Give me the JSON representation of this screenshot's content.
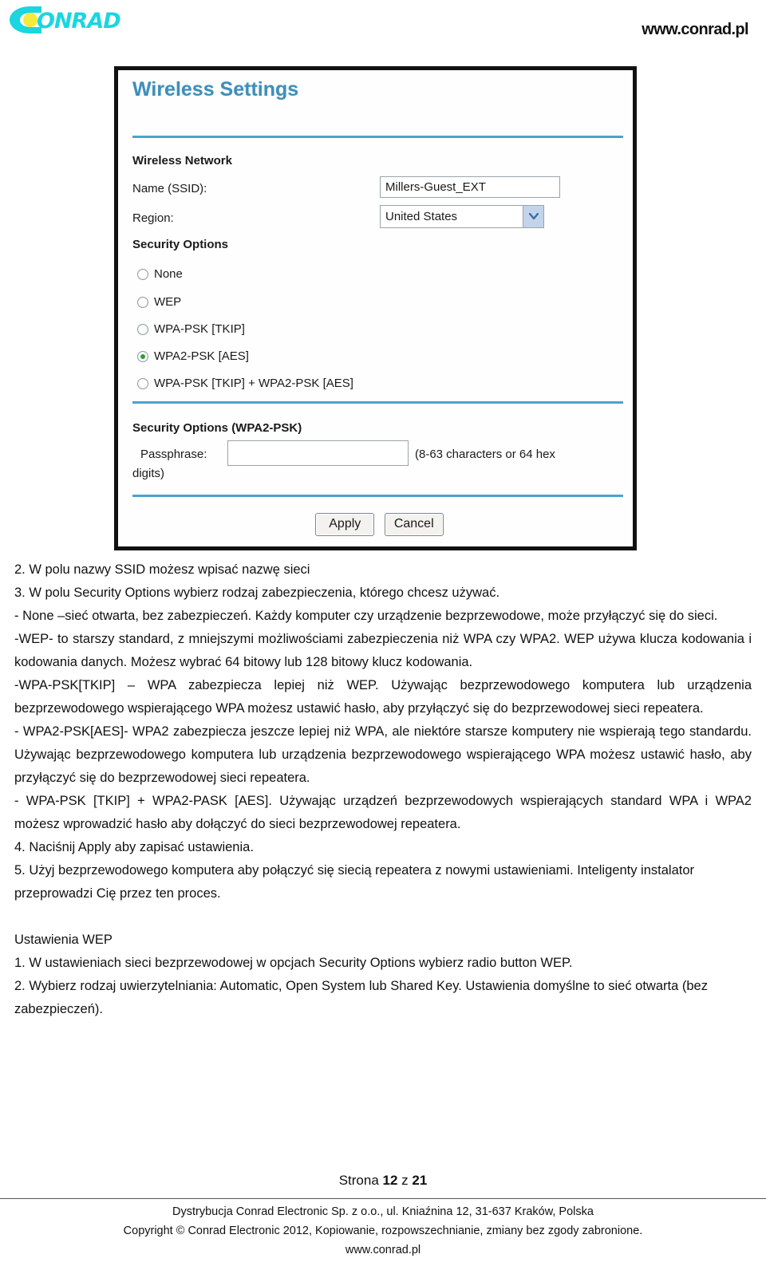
{
  "header": {
    "logo_text": "CONRAD",
    "site_url": "www.conrad.pl"
  },
  "screenshot": {
    "title": "Wireless Settings",
    "section_wireless_network": "Wireless Network",
    "label_name_ssid": "Name (SSID):",
    "ssid_value": "Millers-Guest_EXT",
    "label_region": "Region:",
    "region_value": "United States",
    "section_security_options": "Security Options",
    "security_options": [
      {
        "label": "None",
        "selected": false
      },
      {
        "label": "WEP",
        "selected": false
      },
      {
        "label": "WPA-PSK [TKIP]",
        "selected": false
      },
      {
        "label": "WPA2-PSK [AES]",
        "selected": true
      },
      {
        "label": "WPA-PSK [TKIP] + WPA2-PSK [AES]",
        "selected": false
      }
    ],
    "section_security_options_wpa2": "Security Options (WPA2-PSK)",
    "label_passphrase": "Passphrase:",
    "passphrase_value": "",
    "passphrase_hint": "(8-63 characters or 64 hex",
    "passphrase_hint2": "digits)",
    "apply_label": "Apply",
    "cancel_label": "Cancel"
  },
  "body": {
    "lines": [
      "2. W polu nazwy SSID możesz wpisać nazwę sieci",
      "3. W polu Security Options wybierz rodzaj zabezpieczenia, którego chcesz używać.",
      "- None –sieć otwarta, bez zabezpieczeń. Każdy komputer czy urządzenie bezprzewodowe, może przyłączyć się do sieci.",
      "-WEP- to starszy standard, z mniejszymi możliwościami zabezpieczenia niż WPA czy WPA2. WEP używa klucza kodowania i kodowania danych. Możesz wybrać 64 bitowy lub 128 bitowy klucz kodowania.",
      "-WPA-PSK[TKIP] – WPA zabezpiecza lepiej niż WEP. Używając bezprzewodowego komputera lub urządzenia bezprzewodowego wspierającego WPA możesz ustawić hasło, aby przyłączyć się do bezprzewodowej sieci repeatera.",
      "- WPA2-PSK[AES]- WPA2 zabezpiecza jeszcze lepiej niż WPA, ale niektóre  starsze komputery nie wspierają tego standardu. Używając bezprzewodowego komputera lub urządzenia bezprzewodowego wspierającego WPA możesz ustawić hasło, aby przyłączyć się do bezprzewodowej sieci repeatera.",
      "- WPA-PSK [TKIP] + WPA2-PASK [AES]. Używając urządzeń bezprzewodowych wspierających standard WPA i WPA2 możesz wprowadzić hasło aby dołączyć do sieci bezprzewodowej repeatera.",
      "4. Naciśnij Apply aby zapisać ustawienia.",
      "5. Użyj bezprzewodowego komputera aby połączyć się siecią repeatera z nowymi ustawieniami. Inteligenty instalator przeprowadzi Cię przez ten proces.",
      "",
      "Ustawienia WEP",
      "1. W ustawieniach sieci bezprzewodowej w opcjach Security Options wybierz radio button WEP.",
      "2. Wybierz rodzaj uwierzytelniania: Automatic, Open System lub Shared Key. Ustawienia domyślne to sieć otwarta (bez zabezpieczeń)."
    ]
  },
  "page_number": {
    "prefix": "Strona ",
    "current": "12",
    "middle": " z ",
    "total": "21"
  },
  "footer": {
    "line1": "Dystrybucja Conrad Electronic Sp. z o.o., ul. Kniaźnina 12, 31-637 Kraków, Polska",
    "line2": "Copyright © Conrad Electronic 2012, Kopiowanie, rozpowszechnianie, zmiany bez zgody zabronione.",
    "line3": "www.conrad.pl"
  },
  "colors": {
    "logo_cyan": "#1ad6e0",
    "logo_yellow": "#f6ea3a",
    "panel_heading_blue": "#3e8fba",
    "rule_blue": "#4ba3cf",
    "radio_selected_green": "#2f9e2f"
  }
}
